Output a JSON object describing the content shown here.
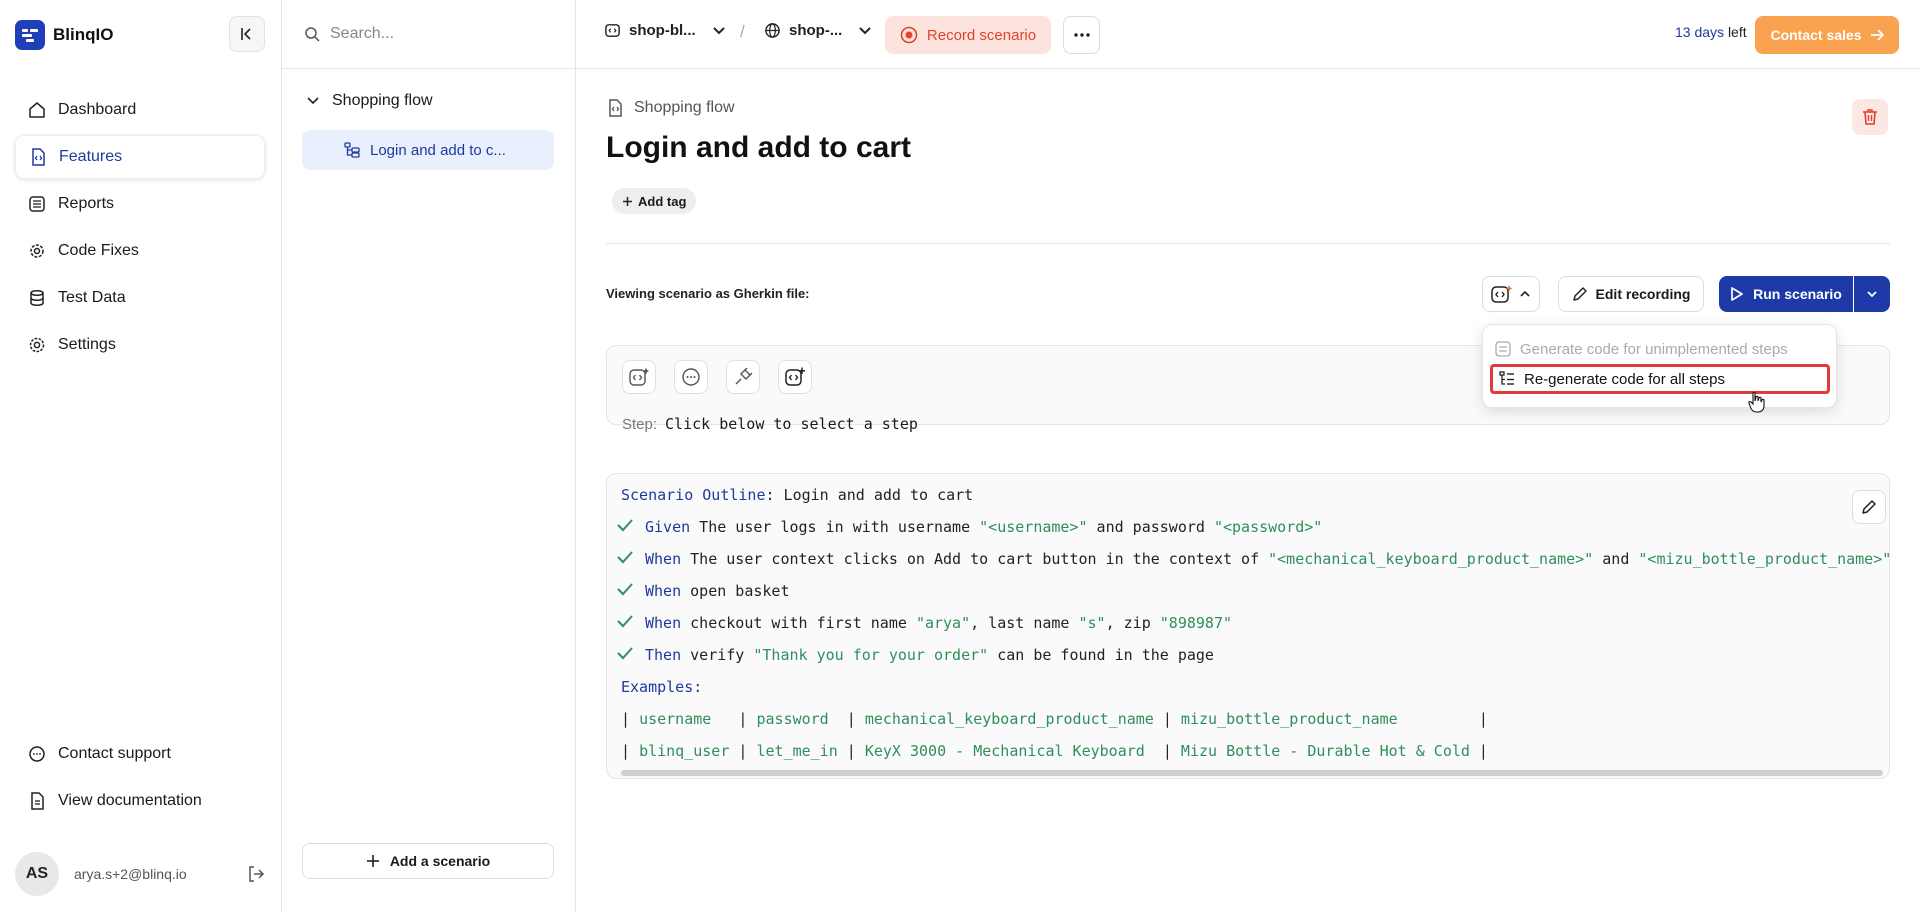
{
  "brand": {
    "name": "BlinqIO"
  },
  "sidebar": {
    "items": [
      {
        "label": "Dashboard"
      },
      {
        "label": "Features"
      },
      {
        "label": "Reports"
      },
      {
        "label": "Code Fixes"
      },
      {
        "label": "Test Data"
      },
      {
        "label": "Settings"
      }
    ],
    "bottom": [
      {
        "label": "Contact support"
      },
      {
        "label": "View documentation"
      }
    ],
    "user": {
      "initials": "AS",
      "email": "arya.s+2@blinq.io"
    }
  },
  "panel": {
    "search_placeholder": "Search...",
    "folder": "Shopping flow",
    "scenario": "Login and add to c...",
    "add_scenario": "Add a scenario"
  },
  "topbar": {
    "project": "shop-bl...",
    "separator": "/",
    "environment": "shop-...",
    "record": "Record scenario",
    "trial_days": "13 days",
    "trial_suffix": "left",
    "contact_sales": "Contact sales"
  },
  "main": {
    "feature": "Shopping flow",
    "title": "Login and add to cart",
    "add_tag": "Add tag",
    "viewing_label": "Viewing scenario as Gherkin file:",
    "edit_recording": "Edit recording",
    "run_scenario": "Run scenario",
    "step_label": "Step:",
    "step_hint": "Click below to select a step"
  },
  "dropdown": {
    "generate_unimplemented": "Generate code for unimplemented steps",
    "regenerate_all": "Re-generate code for all steps"
  },
  "gherkin": {
    "outline_kw": "Scenario Outline",
    "outline_title": ": Login and add to cart",
    "steps": [
      {
        "kw": "Given",
        "parts": [
          " The user logs in with username ",
          "\"<username>\"",
          " and password ",
          "\"<password>\""
        ]
      },
      {
        "kw": "When",
        "parts": [
          " The user context clicks on Add to cart button in the context of ",
          "\"<mechanical_keyboard_product_name>\"",
          " and ",
          "\"<mizu_bottle_product_name>\""
        ]
      },
      {
        "kw": "When",
        "parts": [
          " open basket"
        ]
      },
      {
        "kw": "When",
        "parts": [
          " checkout with first name ",
          "\"arya\"",
          ", last name ",
          "\"s\"",
          ", zip ",
          "\"898987\""
        ]
      },
      {
        "kw": "Then",
        "parts": [
          " verify ",
          "\"Thank you for your order\"",
          " can be found in the page"
        ]
      }
    ],
    "examples_kw": "Examples:",
    "table": [
      [
        "username  ",
        "password ",
        "mechanical_keyboard_product_name",
        "mizu_bottle_product_name        "
      ],
      [
        "blinq_user",
        "let_me_in",
        "KeyX 3000 - Mechanical Keyboard ",
        "Mizu Bottle - Durable Hot & Cold"
      ]
    ]
  }
}
